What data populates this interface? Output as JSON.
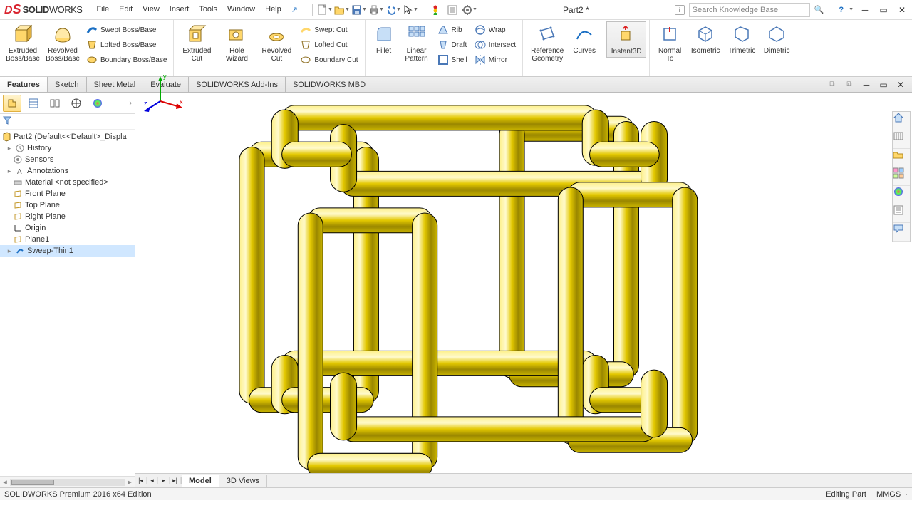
{
  "app": {
    "logo_prefix": "S",
    "logo_solid": "SOLID",
    "logo_works": "WORKS"
  },
  "menus": [
    "File",
    "Edit",
    "View",
    "Insert",
    "Tools",
    "Window",
    "Help"
  ],
  "doc_title": "Part2 *",
  "search_placeholder": "Search Knowledge Base",
  "ribbon": {
    "boss": {
      "extruded": "Extruded Boss/Base",
      "revolved": "Revolved Boss/Base",
      "swept": "Swept Boss/Base",
      "lofted": "Lofted Boss/Base",
      "boundary": "Boundary Boss/Base"
    },
    "cut": {
      "extruded": "Extruded Cut",
      "hole": "Hole Wizard",
      "revolved": "Revolved Cut",
      "swept": "Swept Cut",
      "lofted": "Lofted Cut",
      "boundary": "Boundary Cut"
    },
    "feat": {
      "fillet": "Fillet",
      "linpat": "Linear Pattern",
      "rib": "Rib",
      "draft": "Draft",
      "shell": "Shell",
      "wrap": "Wrap",
      "intersect": "Intersect",
      "mirror": "Mirror"
    },
    "ref": {
      "geom": "Reference Geometry",
      "curves": "Curves"
    },
    "instant3d": "Instant3D",
    "views": {
      "normal": "Normal To",
      "iso": "Isometric",
      "tri": "Trimetric",
      "di": "Dimetric"
    }
  },
  "tabs": [
    "Features",
    "Sketch",
    "Sheet Metal",
    "Evaluate",
    "SOLIDWORKS Add-Ins",
    "SOLIDWORKS MBD"
  ],
  "tree": {
    "root": "Part2  (Default<<Default>_Displa",
    "items": [
      "History",
      "Sensors",
      "Annotations",
      "Material <not specified>",
      "Front Plane",
      "Top Plane",
      "Right Plane",
      "Origin",
      "Plane1",
      "Sweep-Thin1"
    ]
  },
  "bottom_tabs": [
    "Model",
    "3D Views"
  ],
  "status": {
    "left": "SOLIDWORKS Premium 2016 x64 Edition",
    "mode": "Editing Part",
    "units": "MMGS"
  },
  "triad": {
    "x": "x",
    "y": "y",
    "z": "z"
  }
}
